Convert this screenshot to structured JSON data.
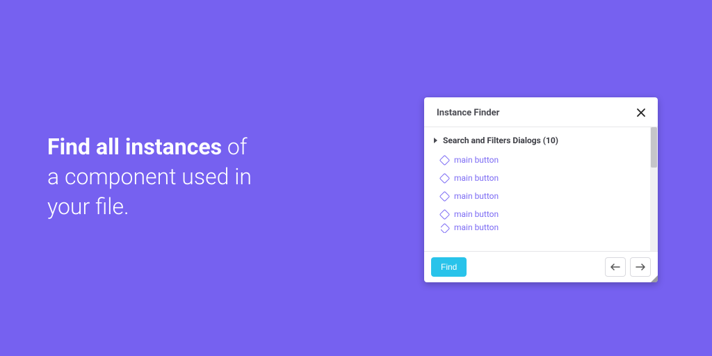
{
  "hero": {
    "bold": "Find all instances",
    "rest_line1": " of",
    "line2": "a component used in",
    "line3": "your file."
  },
  "panel": {
    "title": "Instance Finder",
    "group_label": "Search and Filters Dialogs (10)",
    "items": [
      {
        "label": "main button"
      },
      {
        "label": "main button"
      },
      {
        "label": "main button"
      },
      {
        "label": "main button"
      },
      {
        "label": "main button"
      }
    ],
    "find_label": "Find"
  }
}
